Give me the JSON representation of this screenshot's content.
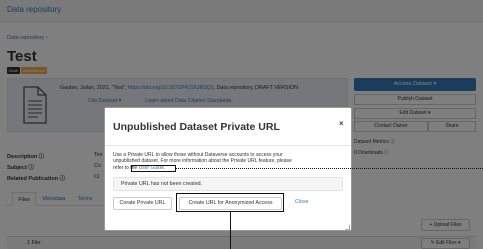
{
  "topbar": {
    "brand": "Data repository"
  },
  "breadcrumb": "Data repository ›",
  "dataset": {
    "title": "Test",
    "badges": {
      "draft": "Draft",
      "unpublished": "Unpublished"
    },
    "citation": {
      "text_prefix": "Gautier, Julian, 2021, \"Test\", ",
      "doi": "https://doi.org/10.5072/FK2/XJ8OQ1",
      "text_suffix": ", Data repository, DRAFT VERSION",
      "cite_dataset": "Cite Dataset ▾",
      "learn_more": "Learn about Data Citation Standards."
    }
  },
  "right_panel": {
    "access_dataset": "Access Dataset ▾",
    "publish_dataset": "Publish Dataset",
    "edit_dataset": "Edit Dataset ▾",
    "contact_owner": "Contact Owner",
    "share": "Share",
    "metrics_label": "Dataset Metrics ⓘ",
    "downloads": "0 Downloads ⓘ"
  },
  "metadata": {
    "description": {
      "label": "Description ⓘ",
      "value": "Tes"
    },
    "subject": {
      "label": "Subject ⓘ",
      "value": "Co"
    },
    "related_publication": {
      "label": "Related Publication ⓘ",
      "value": "Ci"
    }
  },
  "tabs": {
    "files": "Files",
    "metadata": "Metadata",
    "terms": "Terms"
  },
  "files": {
    "upload": "+ Upload Files",
    "count": "1 File",
    "edit_files": "✎ Edit Files ▾"
  },
  "modal": {
    "title": "Unpublished Dataset Private URL",
    "close_icon": "×",
    "desc_line1": "Use a Private URL to allow those without Dataverse accounts to access your",
    "desc_line2": "unpublished dataset. For more information about the Private URL feature, please",
    "desc_line3_prefix": "refer to the ",
    "user_guide": "User Guide",
    "desc_line3_suffix": ".",
    "status": "Private URL has not been created.",
    "create_button": "Create Private URL",
    "anon_button": "Create URL for Anonymized Access",
    "close_link": "Close"
  }
}
